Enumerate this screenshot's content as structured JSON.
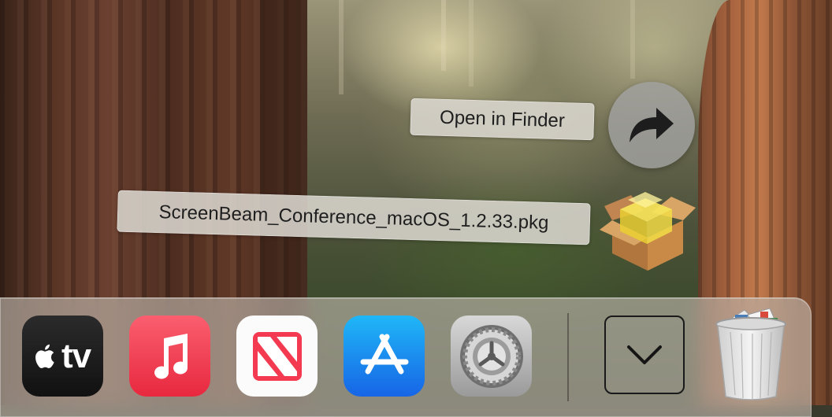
{
  "popup": {
    "open_in_finder_label": "Open in Finder",
    "open_in_finder_icon": "arrow-turn-right-icon",
    "download_file_name": "ScreenBeam_Conference_macOS_1.2.33.pkg",
    "download_file_icon": "package-icon"
  },
  "dock": {
    "apps": [
      {
        "name": "Apple TV",
        "icon": "apple-tv-icon",
        "text": "tv"
      },
      {
        "name": "Music",
        "icon": "music-note-icon"
      },
      {
        "name": "News",
        "icon": "news-icon"
      },
      {
        "name": "App Store",
        "icon": "app-store-icon"
      },
      {
        "name": "System Preferences",
        "icon": "gear-icon"
      }
    ],
    "downloads_stack_icon": "chevron-down-icon",
    "trash_icon": "trash-full-icon"
  },
  "colors": {
    "music_red": "#f43b4f",
    "app_store_blue": "#1a8cf0",
    "news_red": "#f43a51"
  }
}
